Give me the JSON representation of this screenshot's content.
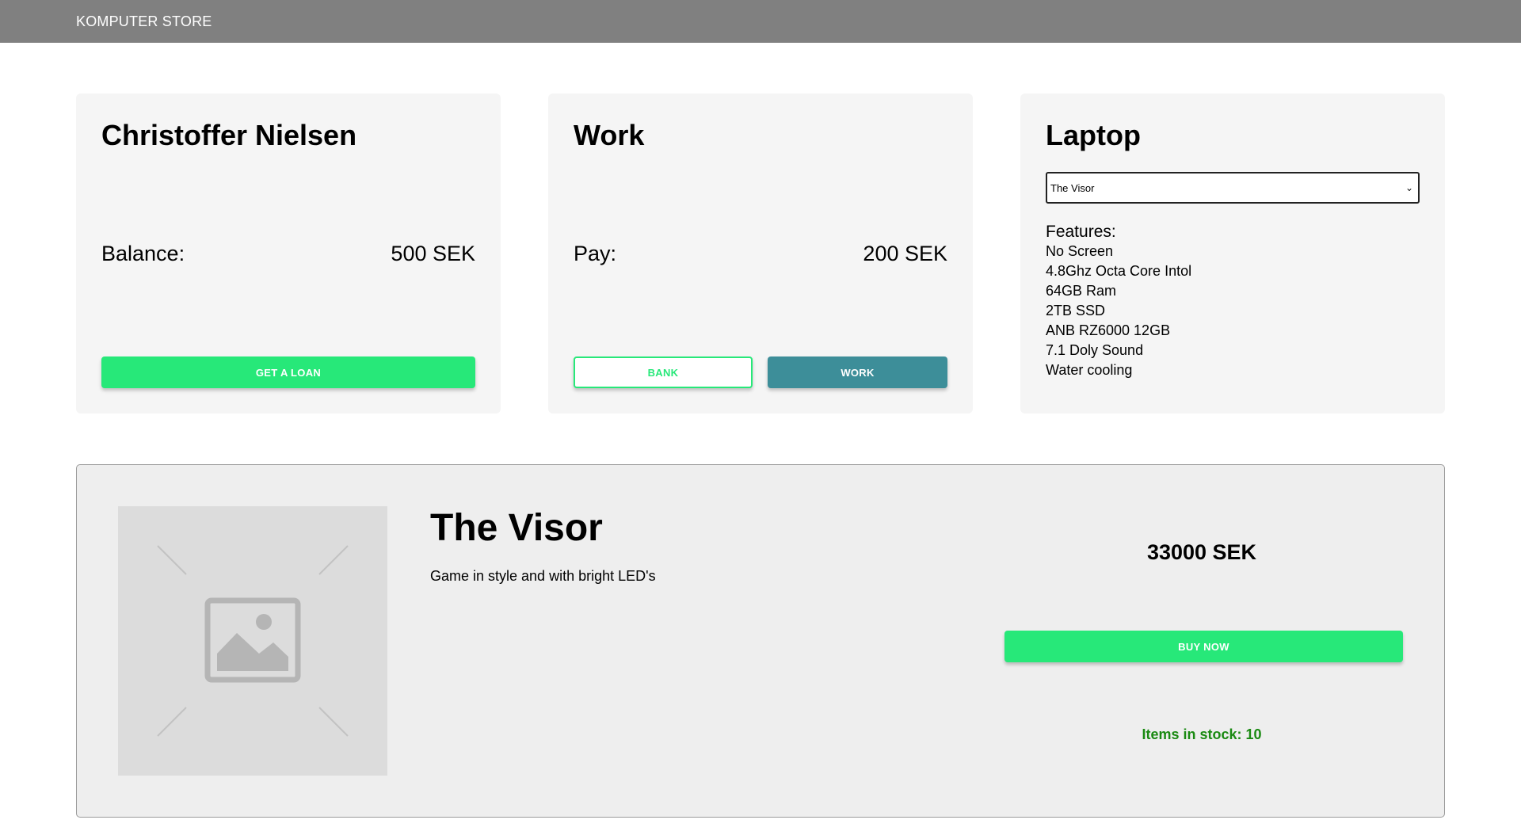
{
  "header": {
    "brand": "KOMPUTER STORE"
  },
  "bank": {
    "title": "Christoffer Nielsen",
    "balance_label": "Balance:",
    "balance_value": "500 SEK",
    "loan_button": "GET A LOAN"
  },
  "work": {
    "title": "Work",
    "pay_label": "Pay:",
    "pay_value": "200 SEK",
    "bank_button": "BANK",
    "work_button": "WORK"
  },
  "laptops": {
    "title": "Laptop",
    "selected": "The Visor",
    "features_title": "Features:",
    "features": [
      "No Screen",
      "4.8Ghz Octa Core Intol",
      "64GB Ram",
      "2TB SSD",
      "ANB RZ6000 12GB",
      "7.1 Doly Sound",
      "Water cooling"
    ]
  },
  "product": {
    "name": "The Visor",
    "description": "Game in style and with bright LED's",
    "price": "33000 SEK",
    "buy_button": "BUY NOW",
    "stock": "Items in stock: 10",
    "image_icon": "image-placeholder-icon"
  },
  "colors": {
    "accent_green": "#27e879",
    "teal": "#3d8e99",
    "stock_green": "#1a8a12",
    "header_gray": "#808080"
  }
}
